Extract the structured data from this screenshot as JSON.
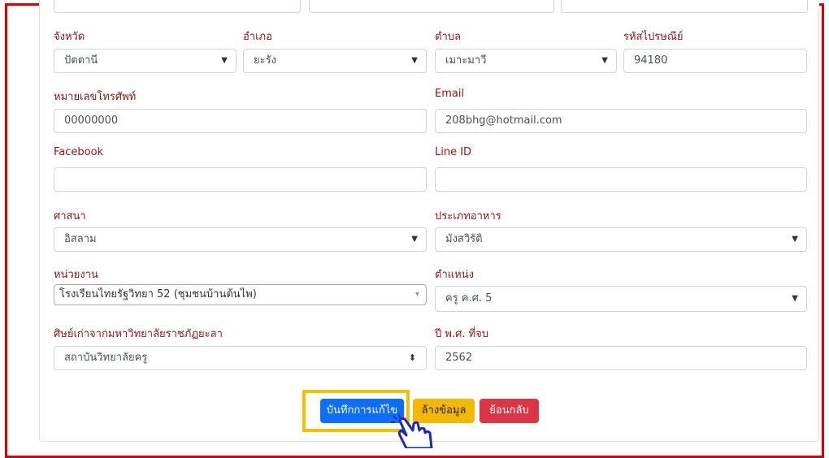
{
  "labels": {
    "province": "จังหวัด",
    "district": "อำเภอ",
    "subdistrict": "ตำบล",
    "postal": "รหัสไปรษณีย์",
    "phone": "หมายเลขโทรศัพท์",
    "email": "Email",
    "facebook": "Facebook",
    "line": "Line ID",
    "religion": "ศาสนา",
    "food": "ประเภทอาหาร",
    "unit": "หน่วยงาน",
    "position": "ตำแหน่ง",
    "alumni": "ศิษย์เก่าจากมหาวิทยาลัยราชภัฏยะลา",
    "grad_year": "ปี พ.ศ. ที่จบ"
  },
  "values": {
    "province": "ปัตตานี",
    "district": "ยะรัง",
    "subdistrict": "เมาะมาวี",
    "postal": "94180",
    "phone": "00000000",
    "email": "208bhg@hotmail.com",
    "facebook": "",
    "line": "",
    "religion": "อิสลาม",
    "food": "มังสวิรัติ",
    "unit": "โรงเรียนไทยรัฐวิทยา 52 (ชุมชนบ้านต้นไพ)",
    "position": "ครู ค.ศ. 5",
    "alumni": "สถาบันวิทยาลัยครู",
    "grad_year": "2562"
  },
  "icons": {
    "dropdown": "▼",
    "select2_arrow": "▾",
    "updown": "⬍"
  },
  "buttons": {
    "save": "บันทึกการแก้ไข",
    "clear": "ล้างข้อมูล",
    "back": "ย้อนกลับ"
  },
  "colors": {
    "save": "#0d6efd",
    "clear": "#f5b800",
    "back": "#dc3545",
    "highlight": "#f5c000",
    "frame": "#e00000",
    "label": "#9a1212"
  }
}
